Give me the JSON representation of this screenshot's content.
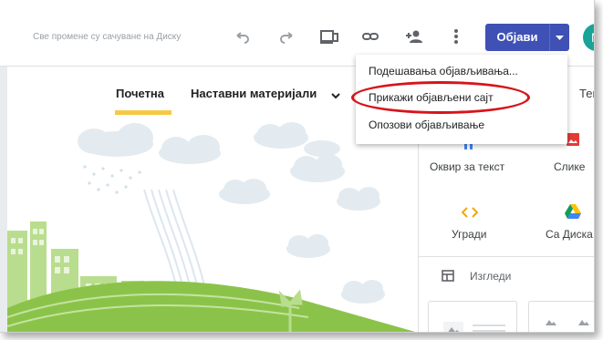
{
  "toolbar": {
    "save_status": "Све промене су сачуване на Диску",
    "publish_label": "Објави",
    "avatar_letter": "N"
  },
  "nav": {
    "items": [
      {
        "label": "Почетна"
      },
      {
        "label": "Наставни материјали"
      }
    ]
  },
  "menu": {
    "items": [
      {
        "label": "Подешавања објављивања..."
      },
      {
        "label": "Прикажи објављени сајт"
      },
      {
        "label": "Опозови објављивање"
      }
    ]
  },
  "panel": {
    "tab_partial": "Тем",
    "insert": [
      {
        "label": "Оквир за текст",
        "icon": "text-box-icon"
      },
      {
        "label": "Слике",
        "icon": "images-icon"
      },
      {
        "label": "Угради",
        "icon": "embed-icon"
      },
      {
        "label": "Са Диска",
        "icon": "drive-icon"
      }
    ],
    "layouts_label": "Изгледи"
  },
  "colors": {
    "accent": "#3f51b5",
    "nav_underline": "#f6c945",
    "highlight": "#d7141b",
    "illustration_green": "#8bc34a",
    "cloud": "#e3ebf0"
  }
}
